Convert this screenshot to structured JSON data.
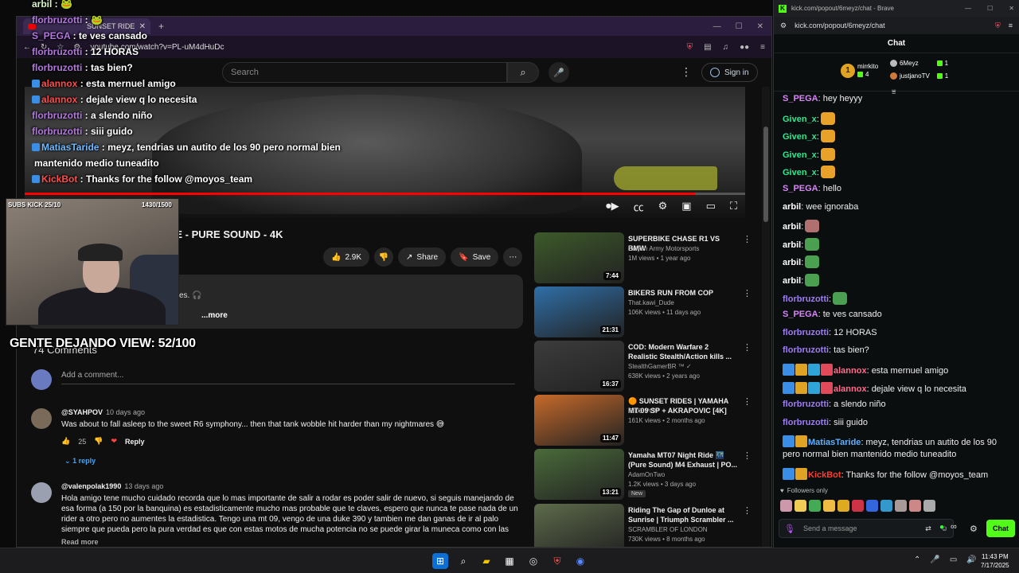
{
  "youtube": {
    "tab_title": "SUNSET RIDE",
    "url": "youtube.com/watch?v=PL-uM4dHuDc",
    "search_placeholder": "Search",
    "signin_label": "Sign in",
    "video_title_visible": "DE - PURE SOUND - 4K",
    "progress_fraction": 0.93,
    "likes": "2.9K",
    "share_label": "Share",
    "save_label": "Save",
    "desc_text_visible": "es. 🎧",
    "more_label": "...more",
    "comments_count_visible": "74 Comments",
    "add_comment_placeholder": "Add a comment...",
    "comments": [
      {
        "author": "@SYAHPOV",
        "time": "10 days ago",
        "body": "Was about to fall asleep to the sweet R6 symphony... then that tank wobble hit harder than my nightmares 😅",
        "likes": "25",
        "reply_label": "Reply",
        "replies_label": "1 reply"
      },
      {
        "author": "@valenpolak1990",
        "time": "13 days ago",
        "body": "Hola amigo tene mucho cuidado recorda que lo mas importante de salir a rodar es poder salir de nuevo, si seguis manejando de esa forma (a 150 por la banquina) es estadisticamente mucho mas probable que te claves, espero que nunca te pase nada de un rider a otro pero no aumentes la estadistica. Tengo una mt 09, vengo de una duke 390 y tambien me dan ganas de ir al palo siempre que pueda pero la pura verdad es que con estas motos de mucha potencia no se puede girar la muneca como con las otras motos, las calles de argentina ..",
        "readmore_label": "Read more"
      }
    ],
    "related": [
      {
        "title": "SUPERBIKE CHASE R1 VS BMW",
        "channel": "Saiyan Army Motorsports",
        "views": "1M views • 1 year ago",
        "duration": "7:44",
        "color": "#3d5a2a"
      },
      {
        "title": "BIKERS RUN FROM COP",
        "channel": "That.kawi_Dude",
        "views": "106K views • 11 days ago",
        "duration": "21:31",
        "color": "#2f6fa8"
      },
      {
        "title": "COD: Modern Warfare 2 Realistic Stealth/Action kills ...",
        "channel": "StealthGamerBR ™ ✓",
        "views": "638K views • 2 years ago",
        "duration": "16:37",
        "color": "#3c3c3c"
      },
      {
        "title": "🟠 SUNSET RIDES | YAMAHA MT-09 SP + AKRAPOVIC [4K]",
        "channel": "RIDE POV",
        "views": "161K views • 2 months ago",
        "duration": "11:47",
        "color": "#c76a2a"
      },
      {
        "title": "Yamaha MT07 Night Ride 🌃 (Pure Sound) M4 Exhaust | PO...",
        "channel": "AdamOnTwo",
        "views": "1.2K views • 3 days ago",
        "duration": "13:21",
        "badge": "New",
        "color": "#4a6b3a"
      },
      {
        "title": "Riding The Gap of Dunloe at Sunrise | Triumph Scrambler ...",
        "channel": "SCRAMBLER OF LONDON",
        "views": "730K views • 8 months ago",
        "duration": "",
        "color": "#5d6b4a"
      }
    ]
  },
  "overlay": {
    "chat_lines": [
      {
        "user": "arbil",
        "text": " : 🐸",
        "cls": "ov-user-green"
      },
      {
        "user": "florbruzotti",
        "text": " : 🐸",
        "cls": "ov-user-purple"
      },
      {
        "user": "S_PEGA",
        "text": " : te ves cansado",
        "cls": "ov-user-purple"
      },
      {
        "user": "florbruzotti",
        "text": " : 12 HORAS",
        "cls": "ov-user-purple"
      },
      {
        "user": "florbruzotti",
        "text": " : tas bien?",
        "cls": "ov-user-purple"
      },
      {
        "user": "alannox",
        "text": " : esta mernuel amigo",
        "cls": "ov-user-red"
      },
      {
        "user": "alannox",
        "text": " : dejale view q lo necesita",
        "cls": "ov-user-red"
      },
      {
        "user": "florbruzotti",
        "text": " : a slendo niño",
        "cls": "ov-user-purple"
      },
      {
        "user": "florbruzotti",
        "text": " : siii guido",
        "cls": "ov-user-purple"
      },
      {
        "user": "MatiasTaride",
        "text": " : meyz, tendrias un autito de los 90 pero normal bien",
        "cls": "ov-user-blue"
      },
      {
        "user": "",
        "text": "mantenido medio tuneadito",
        "cls": ""
      },
      {
        "user": "KickBot",
        "text": " : Thanks for the follow @moyos_team",
        "cls": "ov-user-red"
      }
    ],
    "subs_label": "SUBS KICK 25/10",
    "count_label": "1430/1500",
    "gente_label": "GENTE DEJANDO VIEW: 52/100"
  },
  "kick": {
    "window_title": "kick.com/popout/6meyz/chat - Brave",
    "url": "kick.com/popout/6meyz/chat",
    "header": "Chat",
    "leaders": [
      {
        "rank": "1",
        "name": "mirrkito",
        "value": "4"
      },
      {
        "name": "6Meyz",
        "value": "1"
      },
      {
        "name": "justjanoTV",
        "value": "1"
      }
    ],
    "messages": [
      {
        "user": "S_PEGA",
        "text": ": hey heyyy",
        "cls": "c-pega"
      },
      {
        "user": "Given_x",
        "text": ":",
        "cls": "c-given",
        "emote": "#e8a22a"
      },
      {
        "user": "Given_x",
        "text": ":",
        "cls": "c-given",
        "emote": "#e8a22a"
      },
      {
        "user": "Given_x",
        "text": ":",
        "cls": "c-given",
        "emote": "#e8a22a"
      },
      {
        "user": "Given_x",
        "text": ":",
        "cls": "c-given",
        "emote": "#e8a22a"
      },
      {
        "user": "S_PEGA",
        "text": ": hello",
        "cls": "c-pega"
      },
      {
        "user": "arbil",
        "text": ": wee ignoraba",
        "cls": "c-arbil"
      },
      {
        "user": "arbil",
        "text": ":",
        "cls": "c-arbil",
        "emote": "#b07070"
      },
      {
        "user": "arbil",
        "text": ":",
        "cls": "c-arbil",
        "emote": "#4aa050"
      },
      {
        "user": "arbil",
        "text": ":",
        "cls": "c-arbil",
        "emote": "#4aa050"
      },
      {
        "user": "arbil",
        "text": ":",
        "cls": "c-arbil",
        "emote": "#4aa050"
      },
      {
        "user": "florbruzotti",
        "text": ":",
        "cls": "c-flor",
        "emote": "#4aa050"
      },
      {
        "user": "S_PEGA",
        "text": ": te ves cansado",
        "cls": "c-pega"
      },
      {
        "user": "florbruzotti",
        "text": ": 12 HORAS",
        "cls": "c-flor"
      },
      {
        "user": "florbruzotti",
        "text": ": tas bien?",
        "cls": "c-flor"
      },
      {
        "user": "alannox",
        "text": ": esta mernuel amigo",
        "cls": "c-alan",
        "badges": 4
      },
      {
        "user": "alannox",
        "text": ": dejale view q lo necesita",
        "cls": "c-alan",
        "badges": 4
      },
      {
        "user": "florbruzotti",
        "text": ": a slendo niño",
        "cls": "c-flor"
      },
      {
        "user": "florbruzotti",
        "text": ": siii guido",
        "cls": "c-flor"
      },
      {
        "user": "MatiasTaride",
        "text": ": meyz, tendrias un autito de los 90",
        "cls": "c-matias",
        "badges": 2
      },
      {
        "user": "",
        "text": "pero normal bien mantenido medio tuneadito",
        "cls": ""
      },
      {
        "user": "KickBot",
        "text": ": Thanks for the follow @moyos_team",
        "cls": "c-kickbot",
        "badges": 2
      }
    ],
    "followers_only": "Followers only",
    "input_placeholder": "Send a message",
    "send_label": "Chat"
  },
  "taskbar": {
    "time": "11:43 PM",
    "date": "7/17/2025"
  }
}
